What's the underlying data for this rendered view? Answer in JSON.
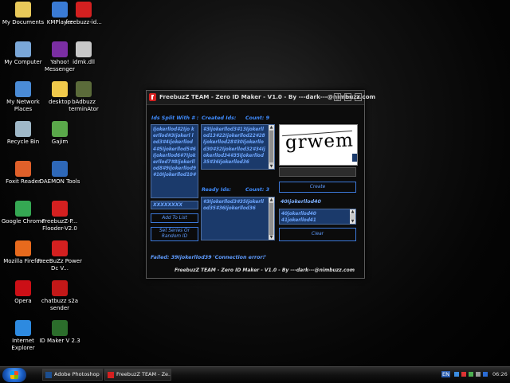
{
  "desktop": {
    "icons": [
      {
        "label": "My Documents",
        "icon": "my-documents-icon"
      },
      {
        "label": "KMPlayer",
        "icon": "kmplayer-icon"
      },
      {
        "label": "freebuzz-id...",
        "icon": "freebuzz-icon"
      },
      {
        "label": "My Computer",
        "icon": "my-computer-icon"
      },
      {
        "label": "Yahoo! Messenger",
        "icon": "yahoo-messenger-icon"
      },
      {
        "label": "idmk.dll",
        "icon": "dll-file-icon"
      },
      {
        "label": "My Network Places",
        "icon": "network-places-icon"
      },
      {
        "label": "desktop",
        "icon": "folder-icon"
      },
      {
        "label": "bAdbuzz terminAtor",
        "icon": "badbuzz-icon"
      },
      {
        "label": "Recycle Bin",
        "icon": "recycle-bin-icon"
      },
      {
        "label": "Gajim",
        "icon": "gajim-icon"
      },
      {
        "label": "Foxit Reader",
        "icon": "foxit-reader-icon"
      },
      {
        "label": "DAEMON Tools",
        "icon": "daemon-tools-icon"
      },
      {
        "label": "Google Chrome",
        "icon": "google-chrome-icon"
      },
      {
        "label": "FreebuzZ-P... Flooder-V2.0",
        "icon": "freebuzz-flooder-icon"
      },
      {
        "label": "Mozilla Firefox",
        "icon": "firefox-icon"
      },
      {
        "label": "FreeBuZz Power Dc V...",
        "icon": "freebuzz-power-icon"
      },
      {
        "label": "Opera",
        "icon": "opera-icon"
      },
      {
        "label": "chatbuzz s2a sender",
        "icon": "chatbuzz-icon"
      },
      {
        "label": "Internet Explorer",
        "icon": "internet-explorer-icon"
      },
      {
        "label": "ID Maker V 2.3",
        "icon": "id-maker-icon"
      }
    ]
  },
  "window": {
    "title": "FreebuzZ TEAM - Zero ID Maker - V1.0 - By ---dark---@nimbuzz.com",
    "ids_split_label": "Ids Split With # :",
    "ids_split_text": "Ijokerllod#2Ijo kerllod#3Ijokerl lod3#4Ijokerllod 4#5Ijokerllod5#6 Ijokerllod6#7Ijok erllod7#8Ijokerll od8#9Ijokerllod9 #10Ijokerllod10#",
    "created_ids_label": "Created Ids:",
    "created_count_label": "Count: 9",
    "created_ids_text": "#3Ijokerllod3#13Ijokerllod13#22Ijokerllod22#28Ijokerllod28#30Ijokerllod30#32Ijokerllod32#34Ijokerllod34#35Ijokerllod35#36Ijokerllod36",
    "ready_ids_label": "Ready Ids:",
    "ready_count_label": "Count: 3",
    "ready_ids_text": "#3Ijokerllod3#35Ijokerllod35#36Ijokerllod36",
    "xxx_field": "XXXXXXXX",
    "add_to_list_button": "Add To List",
    "set_series_button": "Set Series Or Random ID",
    "captcha_text": "grwem",
    "captcha_input_value": "",
    "create_button": "Create",
    "current_id": "40Ijokerllod40",
    "id_list": [
      "40jokerllod40",
      "41jokerllod41"
    ],
    "clear_button": "Clear",
    "status_text": "Failed: 39Ijokerllod39 'Connection error!'",
    "footer_text": "FreebuzZ TEAM - Zero ID Maker - V1.0 - By ---dark---@nimbuzz.com"
  },
  "taskbar": {
    "tasks": [
      "Adobe Photoshop",
      "FreebuzZ TEAM - Ze..."
    ],
    "language": "EN",
    "clock": "06:26"
  }
}
